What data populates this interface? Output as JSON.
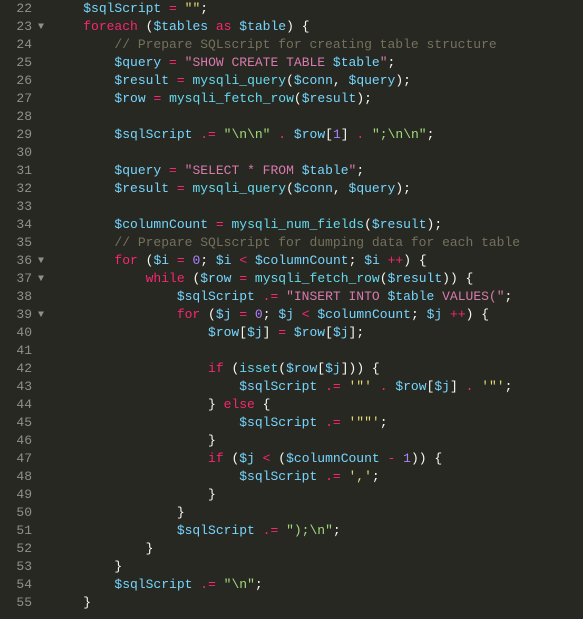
{
  "lines": [
    {
      "num": "22",
      "fold": "",
      "html": "    <span class='var'>$sqlScript</span> <span class='k'>=</span> <span class='str'>\"\"</span>;"
    },
    {
      "num": "23",
      "fold": "▼",
      "html": "    <span class='k'>foreach</span> (<span class='var'>$tables</span> <span class='k'>as</span> <span class='var'>$table</span>) {"
    },
    {
      "num": "24",
      "fold": "",
      "html": "        <span class='cmt'>// Prepare SQLscript for creating table structure</span>"
    },
    {
      "num": "25",
      "fold": "",
      "html": "        <span class='var'>$query</span> <span class='k'>=</span> <span class='rstr'>\"SHOW CREATE TABLE </span><span class='var'>$table</span><span class='rstr'>\"</span>;"
    },
    {
      "num": "26",
      "fold": "",
      "html": "        <span class='var'>$result</span> <span class='k'>=</span> <span class='fn'>mysqli_query</span>(<span class='var'>$conn</span>, <span class='var'>$query</span>);"
    },
    {
      "num": "27",
      "fold": "",
      "html": "        <span class='var'>$row</span> <span class='k'>=</span> <span class='fn'>mysqli_fetch_row</span>(<span class='var'>$result</span>);"
    },
    {
      "num": "28",
      "fold": "",
      "html": ""
    },
    {
      "num": "29",
      "fold": "",
      "html": "        <span class='var'>$sqlScript</span> <span class='k'>.=</span> <span class='strg'>\"\\n\\n\"</span> <span class='k'>.</span> <span class='var'>$row</span>[<span class='num'>1</span>] <span class='k'>.</span> <span class='strg'>\";\\n\\n\"</span>;"
    },
    {
      "num": "30",
      "fold": "",
      "html": ""
    },
    {
      "num": "31",
      "fold": "",
      "html": "        <span class='var'>$query</span> <span class='k'>=</span> <span class='rstr'>\"SELECT * FROM </span><span class='var'>$table</span><span class='rstr'>\"</span>;"
    },
    {
      "num": "32",
      "fold": "",
      "html": "        <span class='var'>$result</span> <span class='k'>=</span> <span class='fn'>mysqli_query</span>(<span class='var'>$conn</span>, <span class='var'>$query</span>);"
    },
    {
      "num": "33",
      "fold": "",
      "html": ""
    },
    {
      "num": "34",
      "fold": "",
      "html": "        <span class='var'>$columnCount</span> <span class='k'>=</span> <span class='fn'>mysqli_num_fields</span>(<span class='var'>$result</span>);"
    },
    {
      "num": "35",
      "fold": "",
      "html": "        <span class='cmt'>// Prepare SQLscript for dumping data for each table</span>"
    },
    {
      "num": "36",
      "fold": "▼",
      "html": "        <span class='k'>for</span> (<span class='var'>$i</span> <span class='k'>=</span> <span class='num'>0</span>; <span class='var'>$i</span> <span class='k'>&lt;</span> <span class='var'>$columnCount</span>; <span class='var'>$i</span> <span class='k'>++</span>) {"
    },
    {
      "num": "37",
      "fold": "▼",
      "html": "            <span class='k'>while</span> (<span class='var'>$row</span> <span class='k'>=</span> <span class='fn'>mysqli_fetch_row</span>(<span class='var'>$result</span>)) {"
    },
    {
      "num": "38",
      "fold": "",
      "html": "                <span class='var'>$sqlScript</span> <span class='k'>.=</span> <span class='rstr'>\"INSERT INTO </span><span class='var'>$table</span><span class='rstr'> VALUES(\"</span>;"
    },
    {
      "num": "39",
      "fold": "▼",
      "html": "                <span class='k'>for</span> (<span class='var'>$j</span> <span class='k'>=</span> <span class='num'>0</span>; <span class='var'>$j</span> <span class='k'>&lt;</span> <span class='var'>$columnCount</span>; <span class='var'>$j</span> <span class='k'>++</span>) {"
    },
    {
      "num": "40",
      "fold": "",
      "html": "                    <span class='var'>$row</span>[<span class='var'>$j</span>] <span class='k'>=</span> <span class='var'>$row</span>[<span class='var'>$j</span>];"
    },
    {
      "num": "41",
      "fold": "",
      "html": ""
    },
    {
      "num": "42",
      "fold": "",
      "html": "                    <span class='k'>if</span> (<span class='fn'>isset</span>(<span class='var'>$row</span>[<span class='var'>$j</span>])) {"
    },
    {
      "num": "43",
      "fold": "",
      "html": "                        <span class='var'>$sqlScript</span> <span class='k'>.=</span> <span class='str'>'\"'</span> <span class='k'>.</span> <span class='var'>$row</span>[<span class='var'>$j</span>] <span class='k'>.</span> <span class='str'>'\"'</span>;"
    },
    {
      "num": "44",
      "fold": "",
      "html": "                    } <span class='k'>else</span> {"
    },
    {
      "num": "45",
      "fold": "",
      "html": "                        <span class='var'>$sqlScript</span> <span class='k'>.=</span> <span class='str'>'\"\"'</span>;"
    },
    {
      "num": "46",
      "fold": "",
      "html": "                    }"
    },
    {
      "num": "47",
      "fold": "",
      "html": "                    <span class='k'>if</span> (<span class='var'>$j</span> <span class='k'>&lt;</span> (<span class='var'>$columnCount</span> <span class='k'>-</span> <span class='num'>1</span>)) {"
    },
    {
      "num": "48",
      "fold": "",
      "html": "                        <span class='var'>$sqlScript</span> <span class='k'>.=</span> <span class='str'>','</span>;"
    },
    {
      "num": "49",
      "fold": "",
      "html": "                    }"
    },
    {
      "num": "50",
      "fold": "",
      "html": "                }"
    },
    {
      "num": "51",
      "fold": "",
      "html": "                <span class='var'>$sqlScript</span> <span class='k'>.=</span> <span class='strg'>\");\\n\"</span>;"
    },
    {
      "num": "52",
      "fold": "",
      "html": "            }"
    },
    {
      "num": "53",
      "fold": "",
      "html": "        }"
    },
    {
      "num": "54",
      "fold": "",
      "html": "        <span class='var'>$sqlScript</span> <span class='k'>.=</span> <span class='strg'>\"\\n\"</span>;"
    },
    {
      "num": "55",
      "fold": "",
      "html": "    }"
    }
  ]
}
